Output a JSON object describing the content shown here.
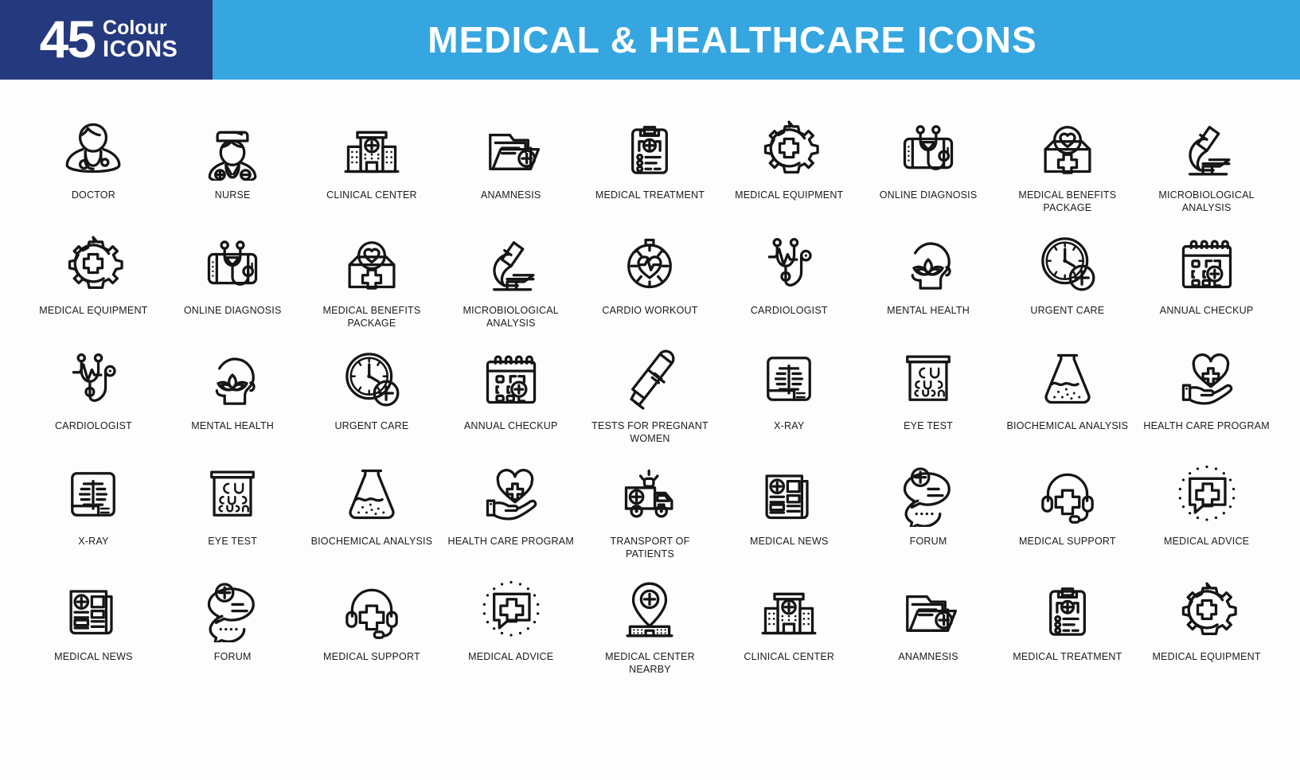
{
  "header": {
    "badge_number": "45",
    "badge_colour": "Colour",
    "badge_icons": "ICONS",
    "title": "MEDICAL & HEALTHCARE ICONS",
    "badge_bg": "#25397e",
    "title_bg": "#36a6e0",
    "title_color": "#ffffff"
  },
  "icons": [
    {
      "label": "DOCTOR",
      "icon": "doctor-icon"
    },
    {
      "label": "NURSE",
      "icon": "nurse-icon"
    },
    {
      "label": "CLINICAL CENTER",
      "icon": "hospital-building-icon"
    },
    {
      "label": "ANAMNESIS",
      "icon": "medical-folder-icon"
    },
    {
      "label": "MEDICAL TREATMENT",
      "icon": "clipboard-checklist-icon"
    },
    {
      "label": "MEDICAL EQUIPMENT",
      "icon": "gear-cross-icon"
    },
    {
      "label": "ONLINE DIAGNOSIS",
      "icon": "phone-stethoscope-icon"
    },
    {
      "label": "MEDICAL BENEFITS PACKAGE",
      "icon": "box-heart-cross-icon"
    },
    {
      "label": "MICROBIOLOGICAL ANALYSIS",
      "icon": "microscope-icon"
    },
    {
      "label": "MEDICAL EQUIPMENT",
      "icon": "gear-cross-icon"
    },
    {
      "label": "ONLINE DIAGNOSIS",
      "icon": "phone-stethoscope-icon"
    },
    {
      "label": "MEDICAL BENEFITS PACKAGE",
      "icon": "box-heart-cross-icon"
    },
    {
      "label": "MICROBIOLOGICAL ANALYSIS",
      "icon": "microscope-icon"
    },
    {
      "label": "CARDIO WORKOUT",
      "icon": "stopwatch-heart-icon"
    },
    {
      "label": "CARDIOLOGIST",
      "icon": "stethoscope-pulse-icon"
    },
    {
      "label": "MENTAL HEALTH",
      "icon": "head-lotus-icon"
    },
    {
      "label": "URGENT CARE",
      "icon": "clock-plus-icon"
    },
    {
      "label": "ANNUAL CHECKUP",
      "icon": "calendar-plus-icon"
    },
    {
      "label": "CARDIOLOGIST",
      "icon": "stethoscope-pulse-icon"
    },
    {
      "label": "MENTAL HEALTH",
      "icon": "head-lotus-icon"
    },
    {
      "label": "URGENT CARE",
      "icon": "clock-plus-icon"
    },
    {
      "label": "ANNUAL CHECKUP",
      "icon": "calendar-plus-icon"
    },
    {
      "label": "TESTS FOR PREGNANT WOMEN",
      "icon": "pregnancy-test-icon"
    },
    {
      "label": "X-RAY",
      "icon": "xray-icon"
    },
    {
      "label": "EYE TEST",
      "icon": "eye-chart-icon"
    },
    {
      "label": "BIOCHEMICAL ANALYSIS",
      "icon": "flask-icon"
    },
    {
      "label": "HEALTH CARE PROGRAM",
      "icon": "hand-heart-cross-icon"
    },
    {
      "label": "X-RAY",
      "icon": "xray-icon"
    },
    {
      "label": "EYE TEST",
      "icon": "eye-chart-icon"
    },
    {
      "label": "BIOCHEMICAL ANALYSIS",
      "icon": "flask-icon"
    },
    {
      "label": "HEALTH CARE PROGRAM",
      "icon": "hand-heart-cross-icon"
    },
    {
      "label": "TRANSPORT OF PATIENTS",
      "icon": "ambulance-icon"
    },
    {
      "label": "MEDICAL NEWS",
      "icon": "newspaper-icon"
    },
    {
      "label": "FORUM",
      "icon": "chat-bubbles-icon"
    },
    {
      "label": "MEDICAL SUPPORT",
      "icon": "headset-icon"
    },
    {
      "label": "MEDICAL ADVICE",
      "icon": "chat-cross-dotted-icon"
    },
    {
      "label": "MEDICAL NEWS",
      "icon": "newspaper-icon"
    },
    {
      "label": "FORUM",
      "icon": "chat-bubbles-icon"
    },
    {
      "label": "MEDICAL SUPPORT",
      "icon": "headset-icon"
    },
    {
      "label": "MEDICAL ADVICE",
      "icon": "chat-cross-dotted-icon"
    },
    {
      "label": "MEDICAL CENTER NEARBY",
      "icon": "map-pin-hospital-icon"
    },
    {
      "label": "CLINICAL CENTER",
      "icon": "hospital-building-icon"
    },
    {
      "label": "ANAMNESIS",
      "icon": "medical-folder-icon"
    },
    {
      "label": "MEDICAL TREATMENT",
      "icon": "clipboard-checklist-icon"
    },
    {
      "label": "MEDICAL EQUIPMENT",
      "icon": "gear-cross-icon"
    }
  ]
}
